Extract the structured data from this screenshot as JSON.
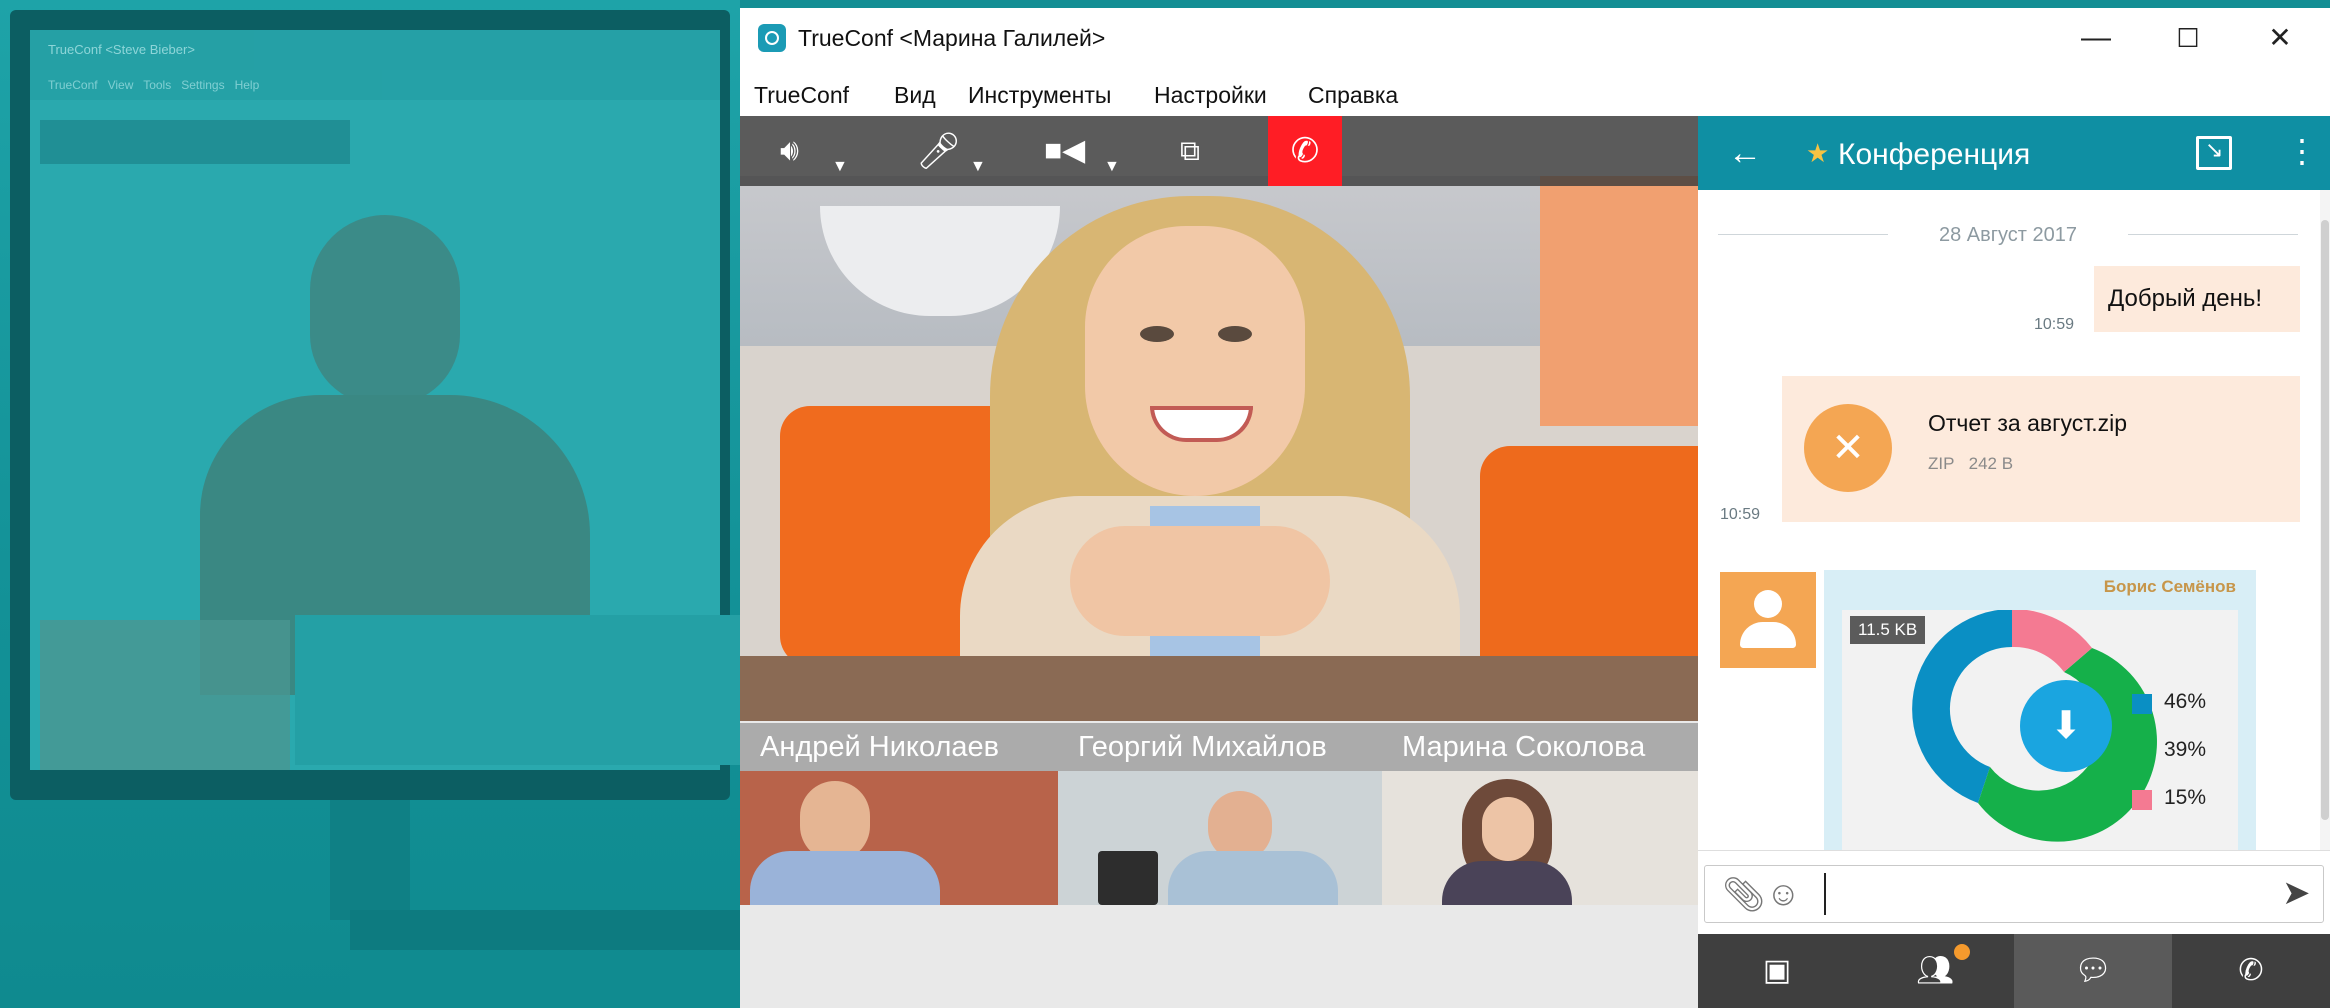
{
  "background_app": {
    "title": "TrueConf <Steve Bieber>",
    "menu": [
      "TrueConf",
      "View",
      "Tools",
      "Settings",
      "Help"
    ]
  },
  "window": {
    "title": "TrueConf <Марина Галилей>",
    "controls": {
      "minimize": "—",
      "maximize": "☐",
      "close": "✕"
    }
  },
  "menu": {
    "items": [
      "TrueConf",
      "Вид",
      "Инструменты",
      "Настройки",
      "Справка"
    ]
  },
  "call_toolbar": {
    "icons": [
      "speaker-icon",
      "microphone-icon",
      "camera-icon",
      "screen-share-icon",
      "hangup-icon"
    ],
    "hangup_color": "#ff1d25"
  },
  "participants": [
    "Андрей Николаев",
    "Георгий Михайлов",
    "Марина Соколова"
  ],
  "chat": {
    "title": "Конференция",
    "header_color": "#0f8fa3",
    "date": "28 Август 2017",
    "messages": [
      {
        "text": "Добрый день!",
        "time": "10:59"
      }
    ],
    "file": {
      "name": "Отчет за август.zip",
      "type": "ZIP",
      "size": "242 B",
      "time": "10:59"
    },
    "image_message": {
      "sender": "Борис Семёнов",
      "size": "11.5 KB",
      "legend": [
        {
          "label": "46%",
          "color": "#0a8fc4"
        },
        {
          "label": "39%",
          "color": "#15b04a"
        },
        {
          "label": "15%",
          "color": "#f47a92"
        }
      ]
    },
    "input_placeholder": ""
  },
  "bottom_nav": {
    "items": [
      "contacts-icon",
      "groups-icon",
      "chat-icon",
      "calls-icon"
    ],
    "active": "chat-icon"
  }
}
